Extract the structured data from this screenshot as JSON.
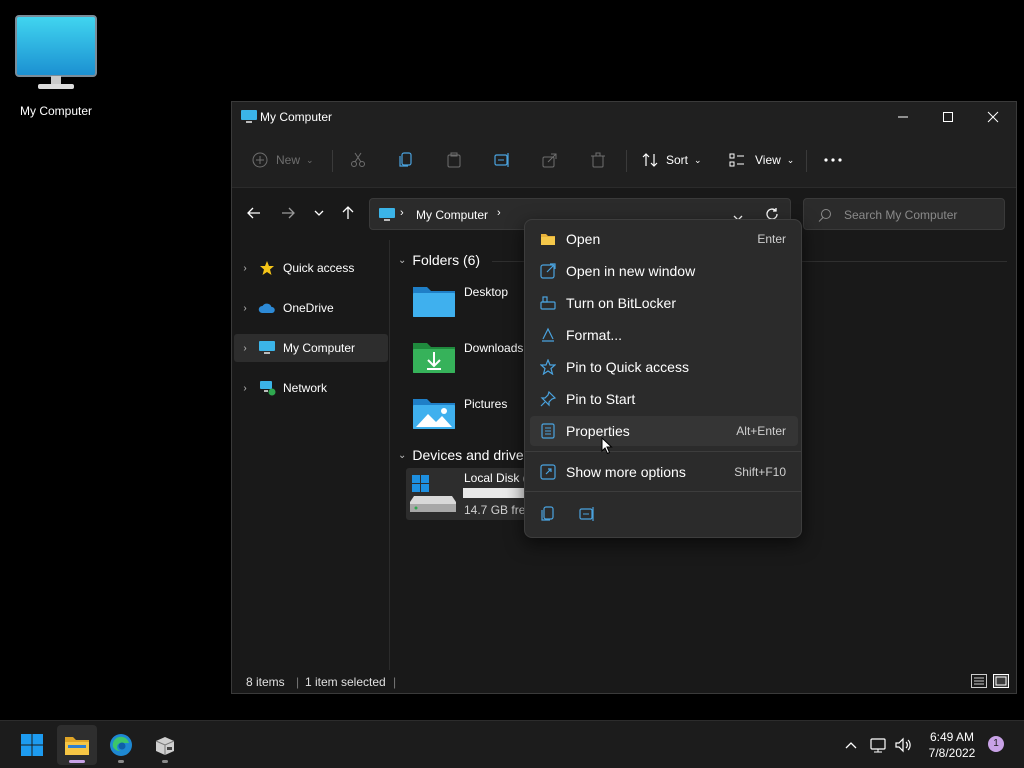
{
  "desktop": {
    "icon_label": "My Computer"
  },
  "window": {
    "title": "My Computer",
    "toolbar": {
      "new_label": "New",
      "sort_label": "Sort",
      "view_label": "View"
    },
    "address": {
      "crumb": "My Computer",
      "search_placeholder": "Search My Computer"
    },
    "sidebar": [
      {
        "label": "Quick access",
        "icon": "star-icon"
      },
      {
        "label": "OneDrive",
        "icon": "cloud-icon"
      },
      {
        "label": "My Computer",
        "icon": "monitor-icon",
        "selected": true
      },
      {
        "label": "Network",
        "icon": "network-icon"
      }
    ],
    "sections": {
      "folders": "Folders (6)",
      "devices": "Devices and drives"
    },
    "folders": [
      {
        "name": "Desktop"
      },
      {
        "name": "Downloads"
      },
      {
        "name": "Pictures"
      }
    ],
    "drive": {
      "name": "Local Disk (",
      "free": "14.7 GB free"
    },
    "status": {
      "count": "8 items",
      "selected": "1 item selected"
    }
  },
  "context_menu": {
    "items": [
      {
        "label": "Open",
        "key": "Enter",
        "icon": "folder-open-icon"
      },
      {
        "label": "Open in new window",
        "key": "",
        "icon": "external-window-icon"
      },
      {
        "label": "Turn on BitLocker",
        "key": "",
        "icon": "key-icon"
      },
      {
        "label": "Format...",
        "key": "",
        "icon": "format-icon"
      },
      {
        "label": "Pin to Quick access",
        "key": "",
        "icon": "star-outline-icon"
      },
      {
        "label": "Pin to Start",
        "key": "",
        "icon": "pin-icon"
      },
      {
        "label": "Properties",
        "key": "Alt+Enter",
        "icon": "properties-icon"
      },
      {
        "label": "Show more options",
        "key": "Shift+F10",
        "icon": "more-options-icon"
      }
    ]
  },
  "taskbar": {
    "time": "6:49 AM",
    "date": "7/8/2022",
    "notifications": "1"
  },
  "colors": {
    "accent_folder": "#3aa8e8",
    "downloads_green": "#2fa84f",
    "taskbar_bg": "#1c1c1c"
  }
}
